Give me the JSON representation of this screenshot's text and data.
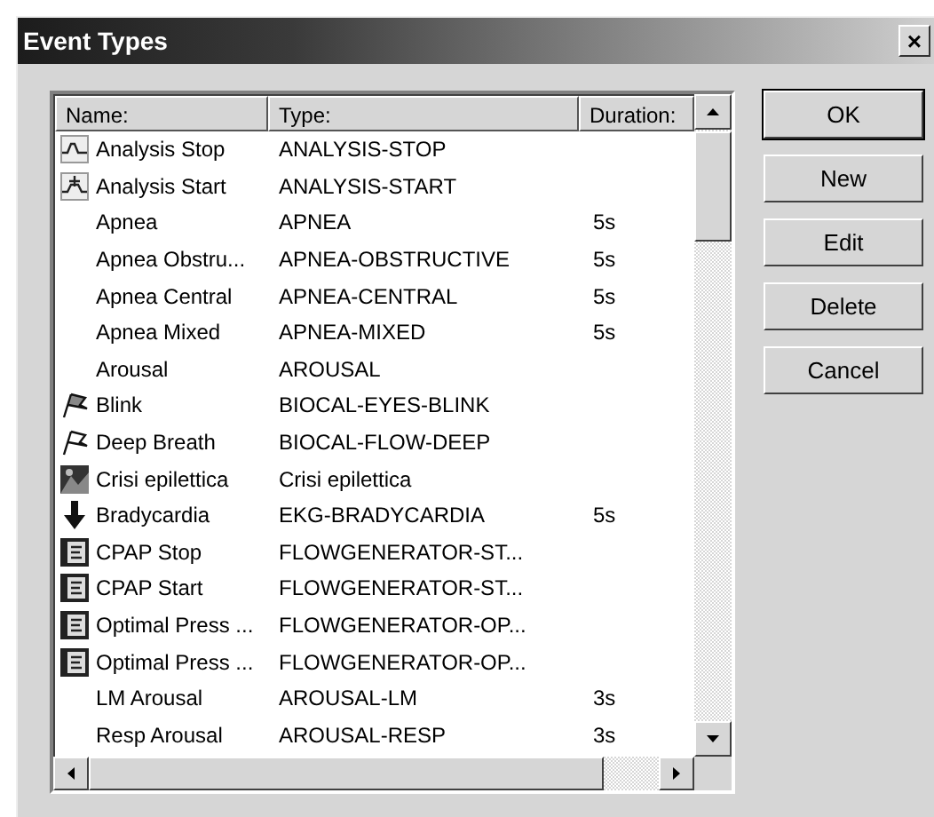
{
  "window": {
    "title": "Event Types",
    "close": "×"
  },
  "table": {
    "columns": [
      "Name:",
      "Type:",
      "Duration:"
    ],
    "rows": [
      {
        "kind": "wave",
        "name": "Analysis Stop",
        "type": "ANALYSIS-STOP"
      },
      {
        "kind": "waveplus",
        "name": "Analysis Start",
        "type": "ANALYSIS-START"
      },
      {
        "kind": "plain",
        "name": "Apnea",
        "type": "APNEA",
        "duration": "5s"
      },
      {
        "kind": "plain",
        "name": "Apnea Obstru...",
        "type": "APNEA-OBSTRUCTIVE",
        "duration": "5s"
      },
      {
        "kind": "plain",
        "name": "Apnea Central",
        "type": "APNEA-CENTRAL",
        "duration": "5s"
      },
      {
        "kind": "plain",
        "name": "Apnea Mixed",
        "type": "APNEA-MIXED",
        "duration": "5s"
      },
      {
        "kind": "plain",
        "name": "Arousal",
        "type": "AROUSAL"
      },
      {
        "kind": "flag",
        "name": "Blink",
        "type": "BIOCAL-EYES-BLINK"
      },
      {
        "kind": "flagoutline",
        "name": "Deep Breath",
        "type": "BIOCAL-FLOW-DEEP"
      },
      {
        "kind": "image",
        "name": "Crisi epilettica",
        "type": "Crisi epilettica"
      },
      {
        "kind": "arrow",
        "name": "Bradycardia",
        "type": "EKG-BRADYCARDIA",
        "duration": "5s"
      },
      {
        "kind": "device",
        "name": "CPAP Stop",
        "type": "FLOWGENERATOR-ST..."
      },
      {
        "kind": "device",
        "name": "CPAP Start",
        "type": "FLOWGENERATOR-ST..."
      },
      {
        "kind": "device",
        "name": "Optimal Press ...",
        "type": "FLOWGENERATOR-OP..."
      },
      {
        "kind": "device",
        "name": "Optimal Press ...",
        "type": "FLOWGENERATOR-OP..."
      },
      {
        "kind": "plain",
        "name": "LM Arousal",
        "type": "AROUSAL-LM",
        "duration": "3s"
      },
      {
        "kind": "plain",
        "name": "Resp Arousal",
        "type": "AROUSAL-RESP",
        "duration": "3s"
      }
    ]
  },
  "buttons": [
    {
      "label": "OK",
      "default": true
    },
    {
      "label": "New",
      "default": false
    },
    {
      "label": "Edit",
      "default": false
    },
    {
      "label": "Delete",
      "default": false
    },
    {
      "label": "Cancel",
      "default": false
    }
  ]
}
